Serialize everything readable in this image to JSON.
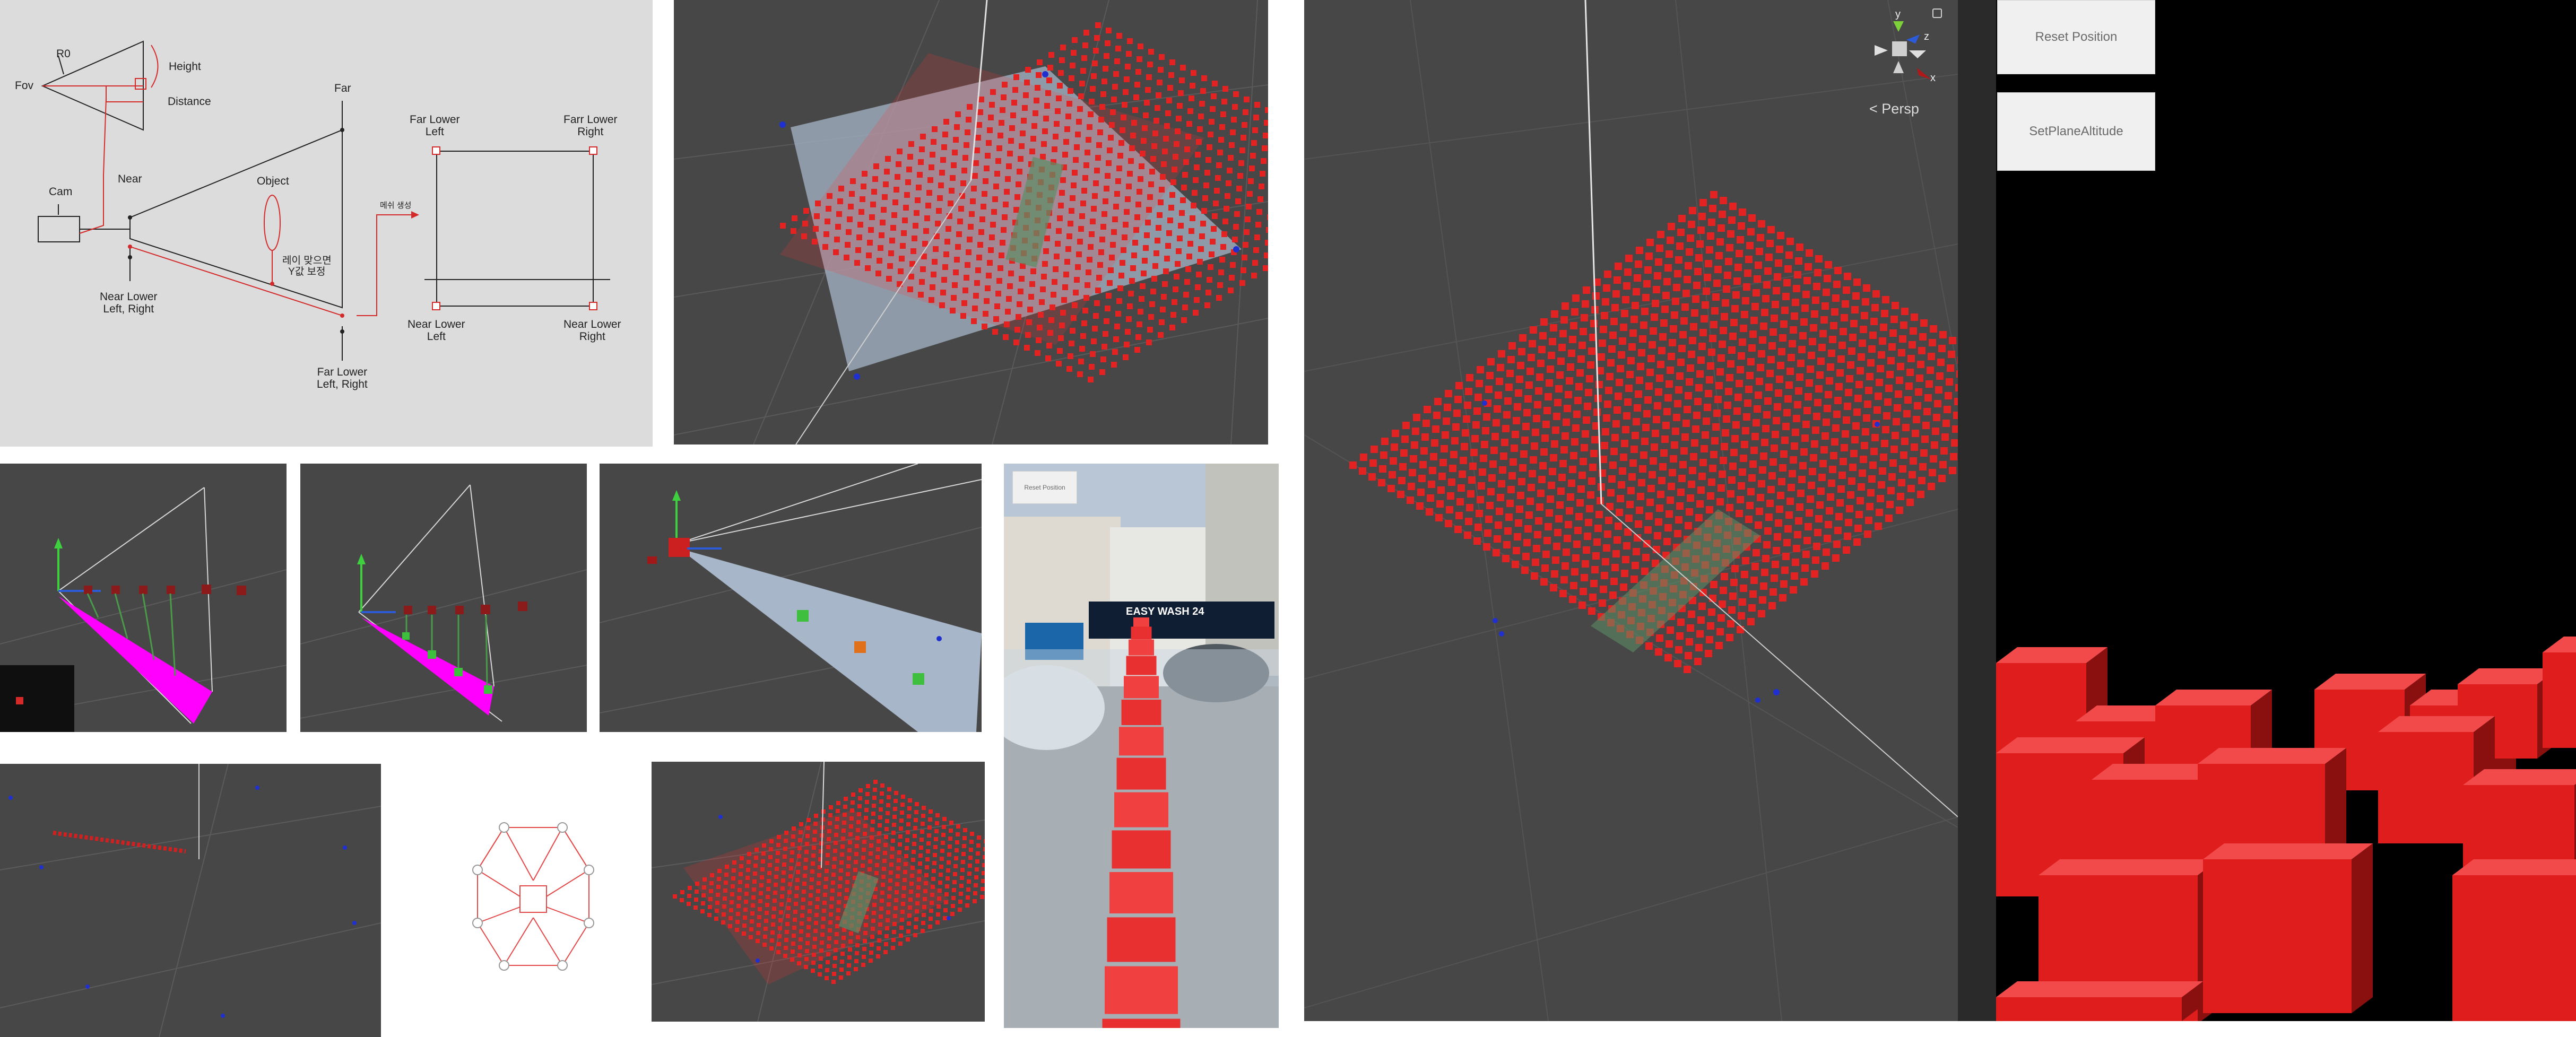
{
  "diagram": {
    "fov": "Fov",
    "r0": "R0",
    "height": "Height",
    "distance": "Distance",
    "cam": "Cam",
    "near": "Near",
    "far": "Far",
    "object": "Object",
    "near_lower": "Near Lower\nLeft, Right",
    "far_lower": "Far Lower\nLeft, Right",
    "ray_hit": "레이 맞으면\nY값 보정",
    "mesh_gen": "메쉬 생성",
    "rect_far_lower_left": "Far Lower\nLeft",
    "rect_far_lower_right": "Farr Lower\nRight",
    "rect_near_lower_left": "Near Lower\nLeft",
    "rect_near_lower_right": "Near Lower\nRight"
  },
  "editor": {
    "persp_label": "Persp",
    "gizmo_y": "y",
    "gizmo_z": "z",
    "gizmo_x": "x"
  },
  "game_view": {
    "reset_button": "Reset Position",
    "altitude_button": "SetPlaneAltitude"
  },
  "phone": {
    "reset_button": "Reset Position",
    "sign_text": "EASY WASH 24"
  },
  "colors": {
    "accent": "#e52222",
    "scene_bg": "#474747",
    "diagram_bg": "#dcdcdc",
    "highlight": "#ff00ff"
  }
}
